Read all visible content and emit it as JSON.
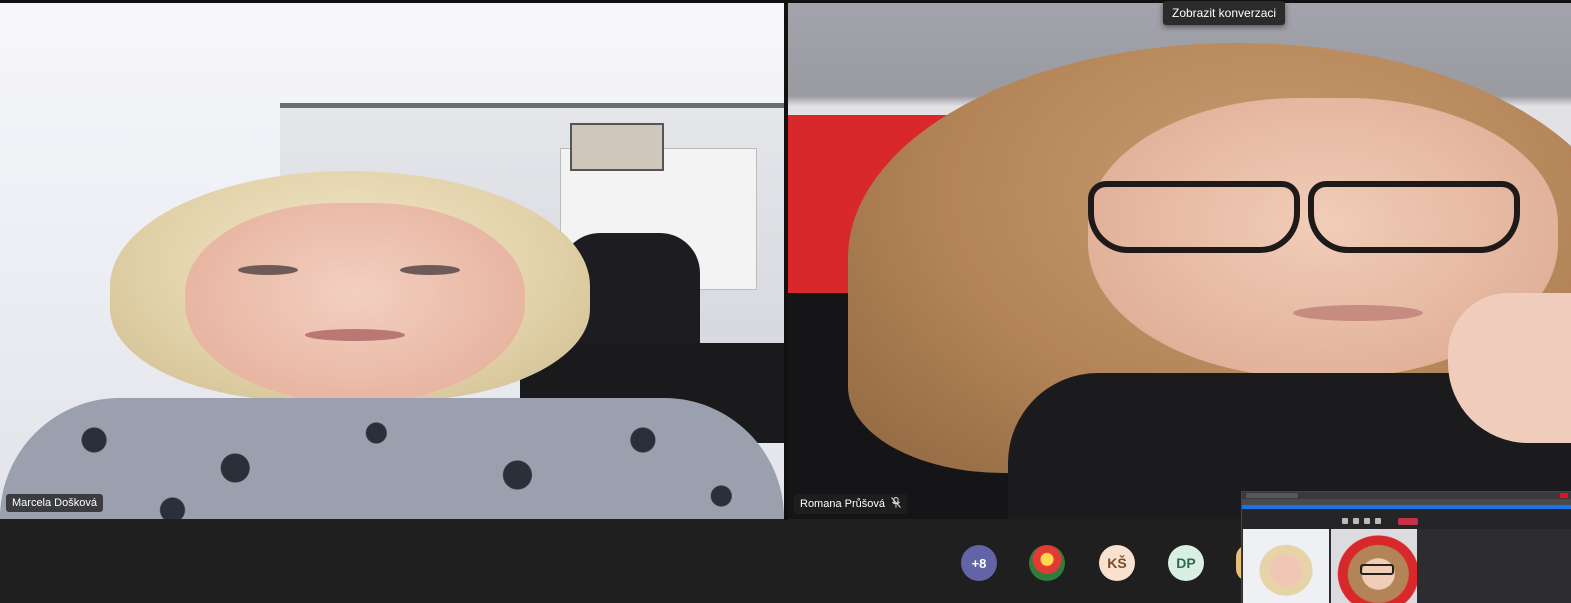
{
  "tooltip": {
    "text": "Zobrazit konverzaci"
  },
  "participants": {
    "left": {
      "name": "Marcela Došková"
    },
    "right": {
      "name": "Romana Průšová",
      "status_icon": "mic-muted-icon"
    }
  },
  "roster": {
    "more_count": "+8",
    "avatars": [
      {
        "type": "photo",
        "icon": "participant-photo"
      },
      {
        "initials": "KŠ",
        "bg": "#f8e2cf"
      },
      {
        "initials": "DP",
        "bg": "#d9efe3"
      }
    ],
    "more_bg": "#6264a7"
  },
  "colors": {
    "background": "#1f1f1f",
    "leave_button": "#c4314b",
    "accent": "#6264a7"
  }
}
